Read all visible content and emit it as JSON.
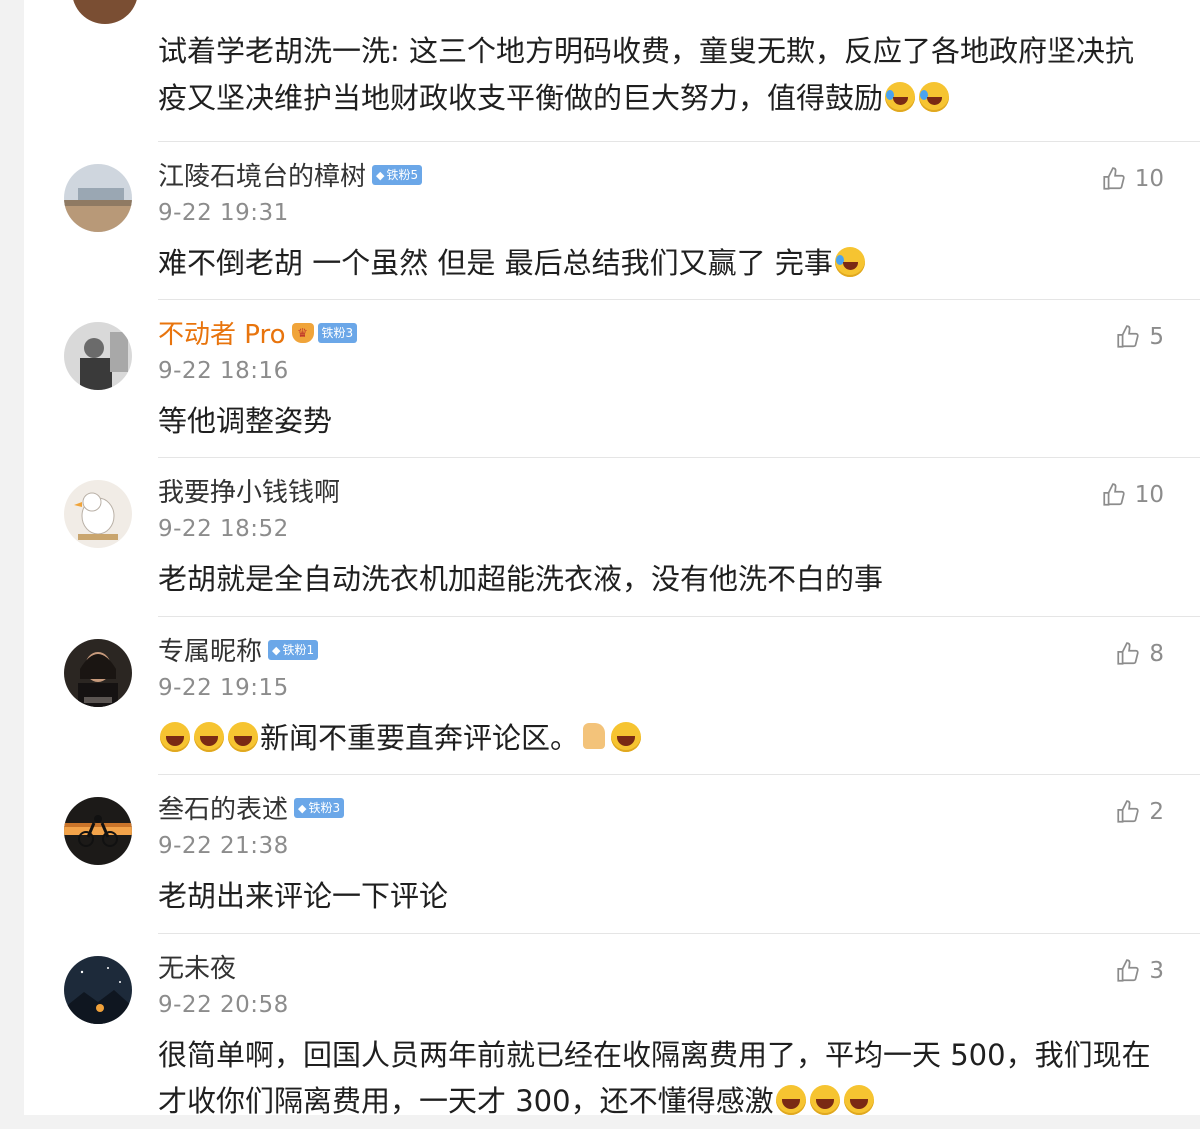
{
  "top_comment": {
    "text": "试着学老胡洗一洗: 这三个地方明码收费，童叟无欺，反应了各地政府坚决抗疫又坚决维护当地财政收支平衡做的巨大努力，值得鼓励"
  },
  "comments": [
    {
      "username": "江陵石境台的樟树",
      "badge": "铁粉5",
      "time": "9-22 19:31",
      "likes": "10",
      "text": "难不倒老胡 一个虽然 但是  最后总结我们又赢了  完事"
    },
    {
      "username": "不动者 Pro",
      "badge": "铁粉3",
      "time": "9-22 18:16",
      "likes": "5",
      "text": "等他调整姿势"
    },
    {
      "username": "我要挣小钱钱啊",
      "time": "9-22 18:52",
      "likes": "10",
      "text": "老胡就是全自动洗衣机加超能洗衣液，没有他洗不白的事"
    },
    {
      "username": "专属昵称",
      "badge": "铁粉1",
      "time": "9-22 19:15",
      "likes": "8",
      "text": "新闻不重要直奔评论区。"
    },
    {
      "username": "叁石的表述",
      "badge": "铁粉3",
      "time": "9-22 21:38",
      "likes": "2",
      "text": "老胡出来评论一下评论"
    },
    {
      "username": "无未夜",
      "time": "9-22 20:58",
      "likes": "3",
      "text": "很简单啊，回国人员两年前就已经在收隔离费用了，平均一天 500，我们现在才收你们隔离费用，一天才 300，还不懂得感激"
    }
  ],
  "colors": {
    "vip_name": "#e8740d",
    "badge_bg": "#6ba7e8",
    "muted": "#8c8c8c"
  },
  "icons": {
    "like": "thumbs-up-icon",
    "cry_laugh": "laughing-crying-emoji",
    "laugh": "grinning-emoji",
    "thumb": "thumbs-up-emoji"
  }
}
